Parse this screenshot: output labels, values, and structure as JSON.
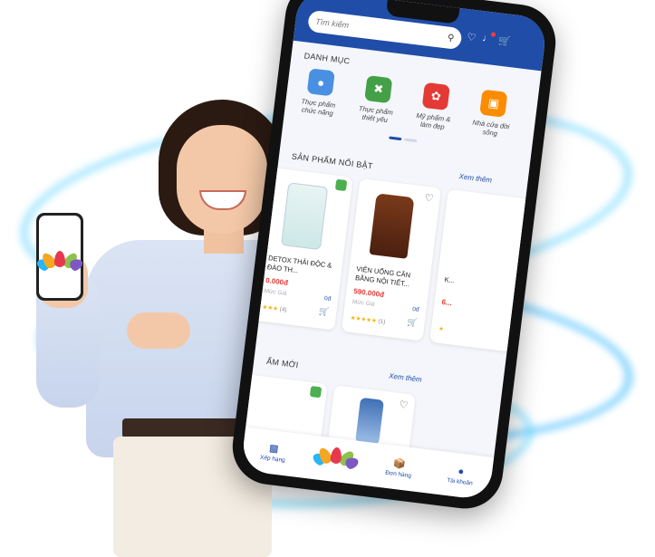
{
  "app": {
    "search_placeholder": "Tìm kiếm",
    "icons": [
      "search-icon",
      "heart-icon",
      "bell-icon",
      "cart-icon"
    ]
  },
  "categories": {
    "title": "DANH MỤC",
    "items": [
      {
        "label": "Thực phẩm chức năng",
        "icon": "supplement-icon",
        "color": "#4a90e2"
      },
      {
        "label": "Thực phẩm thiết yếu",
        "icon": "food-icon",
        "color": "#43a047"
      },
      {
        "label": "Mỹ phẩm & làm đẹp",
        "icon": "beauty-icon",
        "color": "#e53935"
      },
      {
        "label": "Nhà cửa đời sống",
        "icon": "home-icon",
        "color": "#fb8c00"
      }
    ]
  },
  "featured": {
    "title": "SẢN PHẨM NỔI BẬT",
    "more": "Xem thêm",
    "products": [
      {
        "name": "DETOX THẢI ĐỘC & ĐÀO TH...",
        "price": "0.000đ",
        "old_price": "Mức Giá",
        "discount": "0đ",
        "stars": "★★★",
        "count": "(4)"
      },
      {
        "name": "VIÊN UỐNG CÂN BẰNG NỘI TIẾT...",
        "price": "590.000đ",
        "old_price": "Mức Giá",
        "discount": "0đ",
        "stars": "★★★★★",
        "count": "(1)"
      },
      {
        "name": "K...",
        "price": "6...",
        "old_price": "",
        "discount": "",
        "stars": "★",
        "count": ""
      }
    ]
  },
  "new_products": {
    "title": "ẨM MỚI",
    "more": "Xem thêm"
  },
  "tabbar": {
    "items": [
      {
        "label": "Xếp hạng",
        "icon": "ranking-icon"
      },
      {
        "label": "",
        "icon": "lotus-logo-icon"
      },
      {
        "label": "Đơn hàng",
        "icon": "order-icon"
      },
      {
        "label": "Tài khoản",
        "icon": "account-icon"
      }
    ]
  },
  "colors": {
    "brand": "#1f4da8",
    "price": "#e53935",
    "glow": "#50c8ff"
  }
}
